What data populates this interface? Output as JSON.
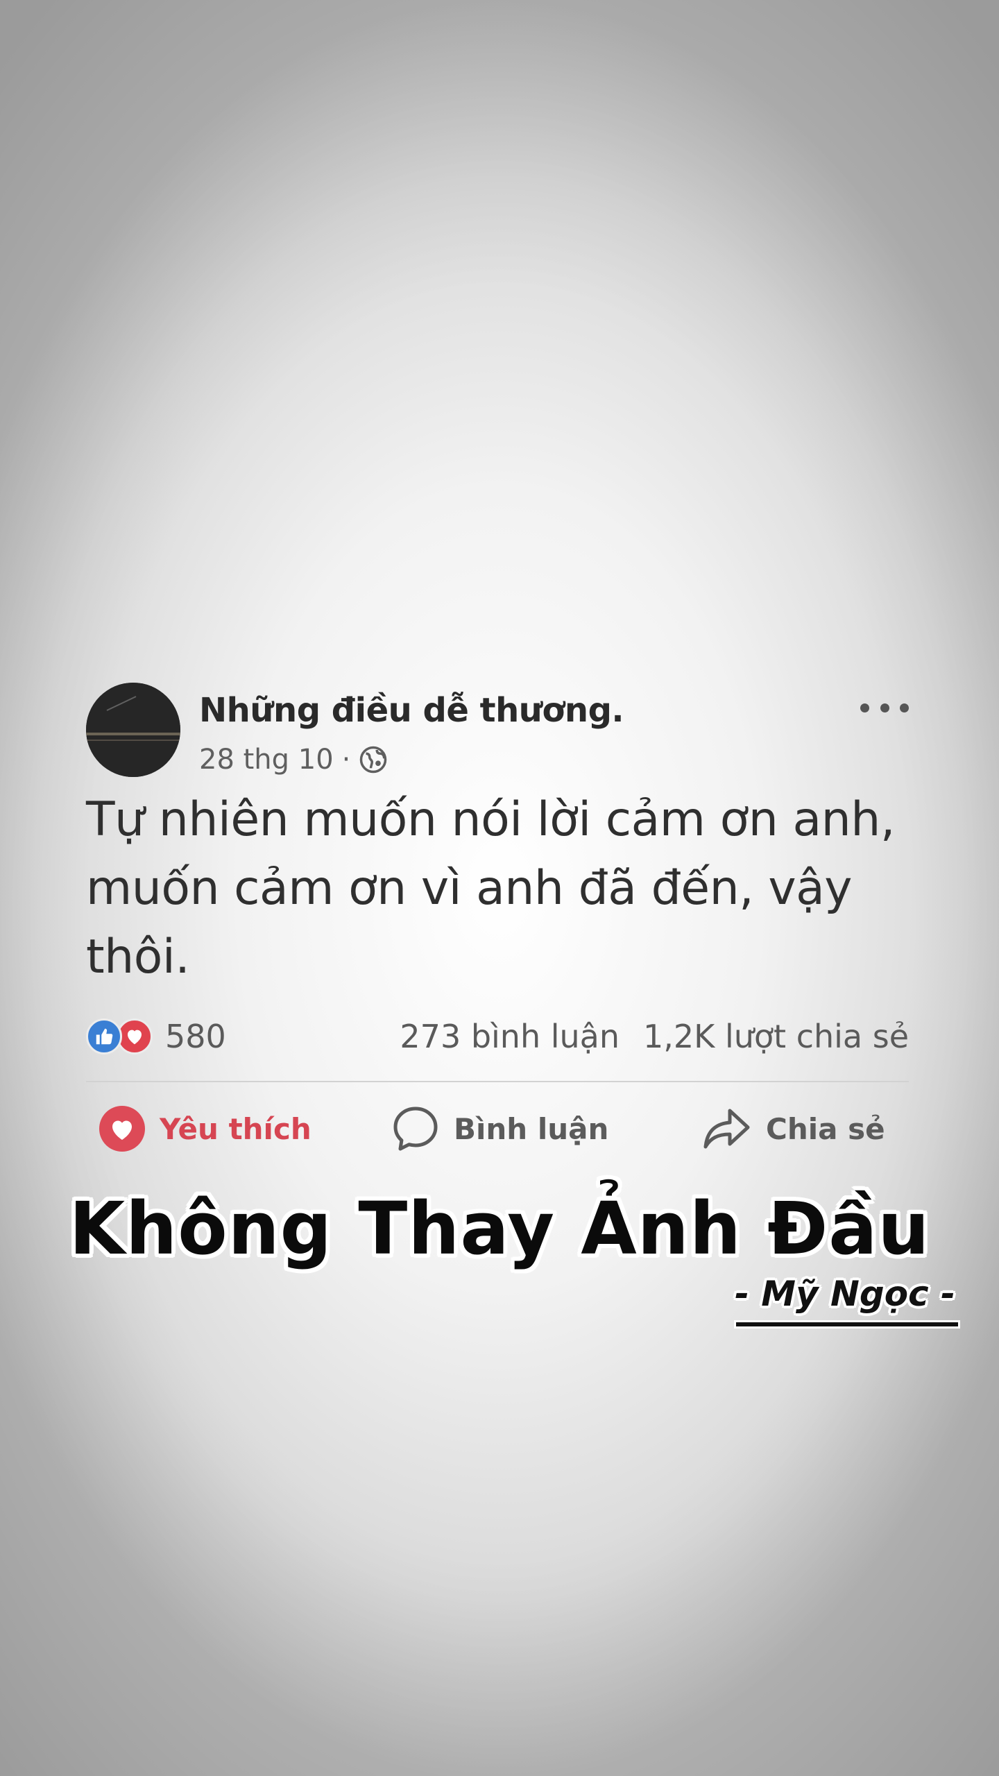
{
  "post": {
    "page_name": "Những điều dễ thương.",
    "date": "28 thg 10",
    "separator": "·",
    "privacy_icon": "globe-icon",
    "more_icon": "more-options-icon",
    "text": "Tự nhiên muốn nói lời cảm ơn anh, muốn cảm ơn vì anh đã đến, vậy thôi."
  },
  "stats": {
    "reaction_icons": [
      "like-icon",
      "love-icon"
    ],
    "reaction_count": "580",
    "comments": "273 bình luận",
    "shares": "1,2K lượt chia sẻ"
  },
  "actions": {
    "like_label": "Yêu thích",
    "comment_label": "Bình luận",
    "share_label": "Chia sẻ"
  },
  "overlay": {
    "headline": "Không Thay Ảnh Đầu",
    "signature": "- Mỹ Ngọc -"
  },
  "colors": {
    "love_red": "#d64552",
    "like_blue": "#3a7fd4",
    "text_dark": "#2f2f2f",
    "text_muted": "#5a5a5a"
  }
}
